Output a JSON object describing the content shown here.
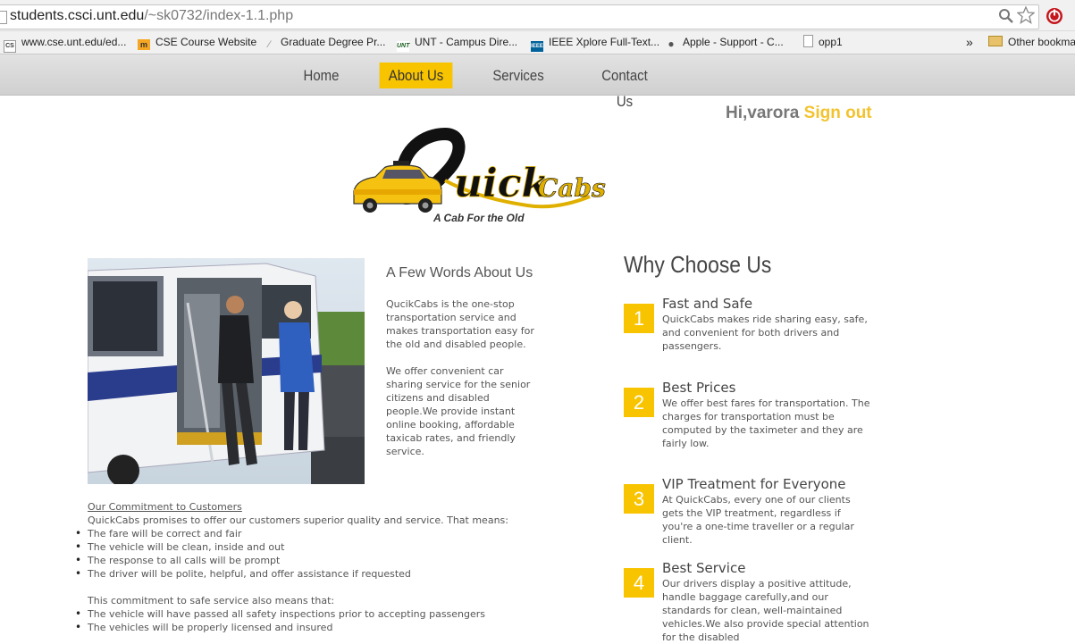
{
  "browser": {
    "url_host": "students.csci.unt.edu",
    "url_path": "/~sk0732/index-1.1.php",
    "bookmarks": [
      {
        "label": "www.cse.unt.edu/ed...",
        "icon": "cse-favicon"
      },
      {
        "label": "CSE Course Website",
        "icon": "moodle-favicon"
      },
      {
        "label": "Graduate Degree Pr...",
        "icon": "feather-favicon"
      },
      {
        "label": "UNT - Campus Dire...",
        "icon": "unt-favicon"
      },
      {
        "label": "IEEE Xplore Full-Text...",
        "icon": "ieee-favicon"
      },
      {
        "label": "Apple - Support - C...",
        "icon": "apple-favicon"
      },
      {
        "label": "opp1",
        "icon": "page-icon"
      }
    ],
    "overflow": "»",
    "other_bookmarks": "Other bookma"
  },
  "nav": {
    "items": [
      {
        "label": "Home"
      },
      {
        "label": "About Us"
      },
      {
        "label": "Services"
      },
      {
        "label": "Contact Us"
      }
    ],
    "active": "About Us"
  },
  "greeting": {
    "hi": "Hi,varora",
    "signout": "Sign out"
  },
  "logo": {
    "text": "QuickCabs",
    "tagline": "A Cab For the Old"
  },
  "about": {
    "title": "A Few Words About Us",
    "p1": "QucikCabs is the one-stop transportation service and makes transportation easy for the old and disabled people.",
    "p2": "We offer convenient car sharing service for the senior citizens and disabled people.We provide instant online booking, affordable taxicab rates, and friendly service."
  },
  "why": {
    "title": "Why Choose Us",
    "features": [
      {
        "num": "1",
        "title": "Fast and Safe",
        "desc": "QuickCabs makes ride sharing easy, safe, and convenient for both drivers and passengers."
      },
      {
        "num": "2",
        "title": "Best Prices",
        "desc": "We offer best fares for transportation. The charges for transportation must be computed by the taximeter and they are fairly low."
      },
      {
        "num": "3",
        "title": "VIP Treatment for Everyone",
        "desc": "At QuickCabs, every one of our clients gets the VIP treatment, regardless if you're a one-time traveller or a regular client."
      },
      {
        "num": "4",
        "title": "Best Service",
        "desc": "Our drivers display a positive attitude, handle baggage carefully,and our standards for clean, well-maintained vehicles.We also provide special attention for the disabled"
      }
    ]
  },
  "commitment": {
    "heading": "Our Commitment to Customers",
    "intro": "QuickCabs promises to offer our customers superior quality and service. That means:",
    "items": [
      "The fare will be correct and fair",
      "The vehicle will be clean, inside and out",
      "The response to all calls will be prompt",
      "The driver will be polite, helpful, and offer assistance if requested"
    ],
    "intro2": "This commitment to safe service also means that:",
    "items2": [
      "The vehicle will have passed all safety inspections prior to accepting passengers",
      "The vehicles will be properly licensed and insured"
    ]
  },
  "colors": {
    "accent": "#f8c400",
    "signout": "#f2c32f"
  }
}
